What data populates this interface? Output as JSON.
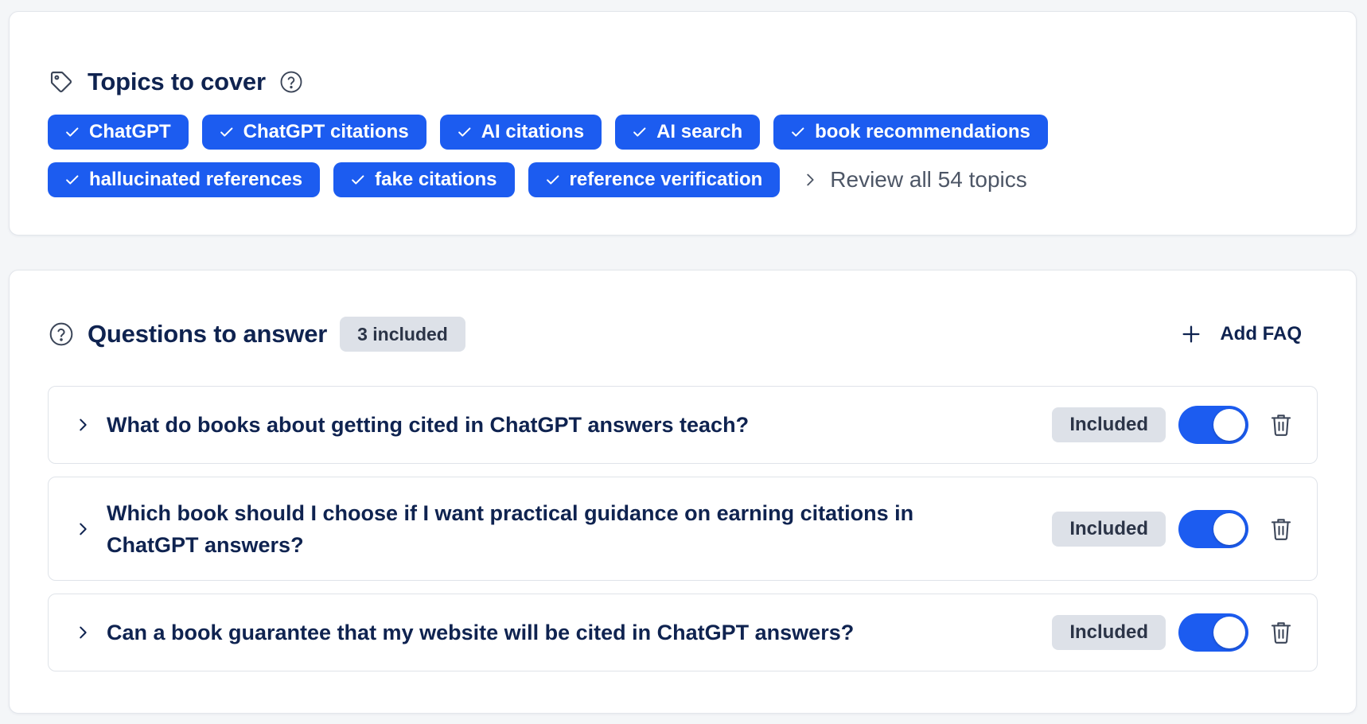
{
  "topics": {
    "title": "Topics to cover",
    "header_icon": "tag-icon",
    "help_icon": "help-circle-icon",
    "chips_row_1": [
      "ChatGPT",
      "ChatGPT citations",
      "AI citations",
      "AI search",
      "book recommendations"
    ],
    "chips_row_2": [
      "hallucinated references",
      "fake citations",
      "reference verification"
    ],
    "review_link": "Review all 54 topics"
  },
  "questions": {
    "title": "Questions to answer",
    "count_badge": "3 included",
    "add_faq_label": "Add FAQ",
    "items": [
      {
        "question": "What do books about getting cited in ChatGPT answers teach?",
        "status": "Included",
        "enabled": true
      },
      {
        "question": "Which book should I choose if I want practical guidance on earning citations in ChatGPT answers?",
        "status": "Included",
        "enabled": true
      },
      {
        "question": "Can a book guarantee that my website will be cited in ChatGPT answers?",
        "status": "Included",
        "enabled": true
      }
    ]
  },
  "colors": {
    "accent": "#1c5cf0",
    "text": "#0f2350",
    "badge_bg": "#dde1e8",
    "page_bg": "#f4f6f8"
  }
}
